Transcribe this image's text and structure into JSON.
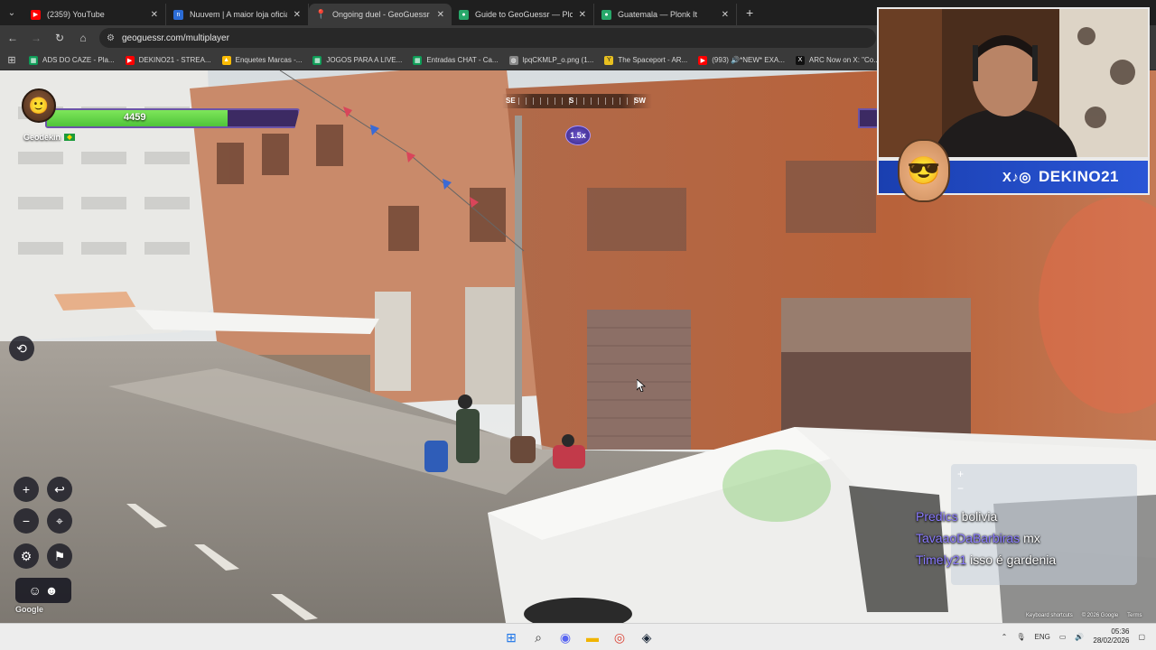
{
  "browser": {
    "tabs": [
      {
        "title": "(2359) YouTube",
        "favicon_color": "#ff0000",
        "favicon_icon": "youtube-icon",
        "active": false
      },
      {
        "title": "Nuuvem | A maior loja oficial de",
        "favicon_color": "#2b6cd6",
        "favicon_icon": "nuuvem-icon",
        "active": false
      },
      {
        "title": "Ongoing duel - GeoGuessr",
        "favicon_color": "#e0454f",
        "favicon_icon": "geoguessr-pin-icon",
        "active": true
      },
      {
        "title": "Guide to GeoGuessr — Plonk It",
        "favicon_color": "#27a86a",
        "favicon_icon": "globe-icon",
        "active": false
      },
      {
        "title": "Guatemala — Plonk It",
        "favicon_color": "#27a86a",
        "favicon_icon": "globe-icon",
        "active": false
      }
    ],
    "url": "geoguessr.com/multiplayer",
    "bookmarks": [
      {
        "label": "ADS DO CAZE - Pla...",
        "color": "#0f9d58"
      },
      {
        "label": "DEKINO21 - STREA...",
        "color": "#ff0000"
      },
      {
        "label": "Enquetes Marcas -...",
        "color": "#fbbc04"
      },
      {
        "label": "JOGOS PARA A LIVE...",
        "color": "#0f9d58"
      },
      {
        "label": "Entradas CHAT - Ca...",
        "color": "#0f9d58"
      },
      {
        "label": "lpqCKMLP_o.png (1...",
        "color": "#888888"
      },
      {
        "label": "The Spaceport - AR...",
        "color": "#e8c020"
      },
      {
        "label": "(993) 🔊*NEW* EXA...",
        "color": "#ff0000"
      },
      {
        "label": "ARC Now on X: \"Co...",
        "color": "#111111"
      }
    ]
  },
  "game": {
    "player_health": "4459",
    "player_health_fraction": 0.72,
    "player_name": "Geodekin",
    "multiplier": "1.5x",
    "compass_labels": [
      "SE",
      "S",
      "SW"
    ]
  },
  "map": {
    "attribution": [
      "Keyboard shortcuts",
      "© 2026 Google",
      "Terms"
    ],
    "logo": "Google"
  },
  "chat": [
    {
      "user": "Predics",
      "message": "bolivia"
    },
    {
      "user": "TavaaoDaBarbiras",
      "message": "mx"
    },
    {
      "user": "Timely21",
      "message": "isso é gardenia"
    }
  ],
  "webcam": {
    "handle": "DEKINO21",
    "socials": "X♪◎"
  },
  "taskbar": {
    "language": "ENG",
    "time": "05:36",
    "date": "28/02/2026"
  }
}
